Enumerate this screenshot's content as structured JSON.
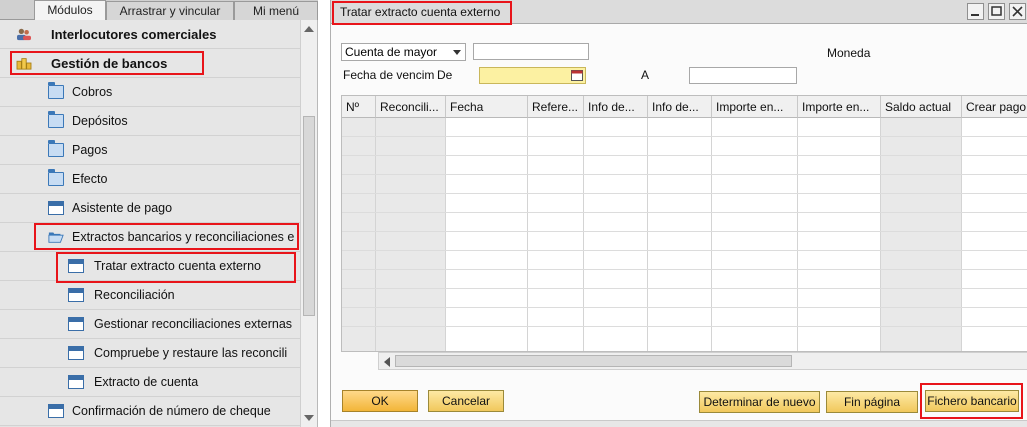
{
  "left": {
    "tabs": [
      {
        "label": "Módulos"
      },
      {
        "label": "Arrastrar y vincular"
      },
      {
        "label": "Mi menú"
      }
    ],
    "items": [
      {
        "label": "Interlocutores comerciales",
        "icon": "people-icon"
      },
      {
        "label": "Gestión de bancos",
        "icon": "coins-icon"
      },
      {
        "label": "Cobros",
        "icon": "folder-icon"
      },
      {
        "label": "Depósitos",
        "icon": "folder-icon"
      },
      {
        "label": "Pagos",
        "icon": "folder-icon"
      },
      {
        "label": "Efecto",
        "icon": "folder-icon"
      },
      {
        "label": "Asistente de pago",
        "icon": "window-icon"
      },
      {
        "label": "Extractos bancarios y reconciliaciones e",
        "icon": "folder-open-icon"
      },
      {
        "label": "Tratar extracto cuenta externo",
        "icon": "window-icon"
      },
      {
        "label": "Reconciliación",
        "icon": "window-icon"
      },
      {
        "label": "Gestionar reconciliaciones externas",
        "icon": "window-icon"
      },
      {
        "label": "Compruebe y restaure las reconcili",
        "icon": "window-icon"
      },
      {
        "label": "Extracto de cuenta",
        "icon": "window-icon"
      },
      {
        "label": "Confirmación de número de cheque",
        "icon": "window-icon"
      }
    ]
  },
  "window": {
    "title": "Tratar extracto cuenta externo",
    "account_type": "Cuenta de mayor",
    "currency_label": "Moneda",
    "due_date_label": "Fecha de vencim",
    "from_label": "De",
    "to_label": "A",
    "columns": [
      {
        "label": "Nº"
      },
      {
        "label": "Reconcili..."
      },
      {
        "label": "Fecha"
      },
      {
        "label": "Refere..."
      },
      {
        "label": "Info de..."
      },
      {
        "label": "Info de..."
      },
      {
        "label": "Importe en..."
      },
      {
        "label": "Importe en..."
      },
      {
        "label": "Saldo actual"
      },
      {
        "label": "Crear pago"
      }
    ],
    "buttons": {
      "ok": "OK",
      "cancel": "Cancelar",
      "determine": "Determinar de nuevo",
      "end_page": "Fin página",
      "bank_file": "Fichero bancario"
    }
  },
  "colors": {
    "highlight": "#e8141a",
    "button_gold": "#f1c85c",
    "date_field": "#fcf1a2"
  }
}
